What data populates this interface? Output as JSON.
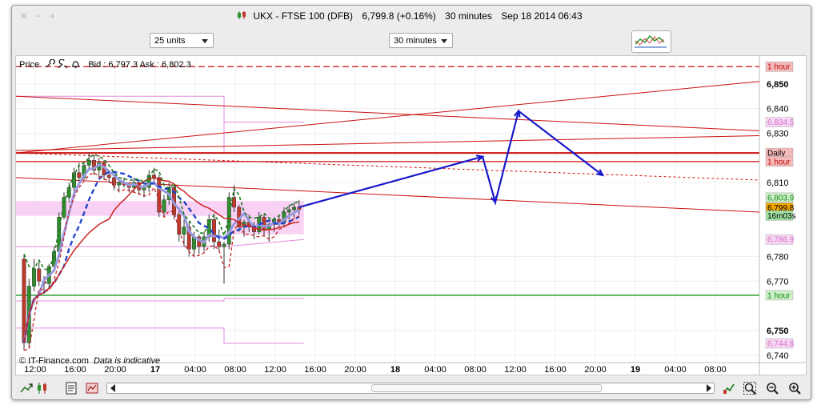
{
  "window": {
    "title_instrument": "UKX - FTSE 100 (DFB)",
    "title_price": "6,799.8 (+0.16%)",
    "title_interval": "30 minutes",
    "title_datetime": "Sep 18 2014 06:43"
  },
  "toolbar": {
    "units_select": "25 units",
    "interval_select": "30 minutes"
  },
  "chart_header": {
    "price_label": "Price",
    "bid_ask": "Bid : 6,797.3 Ask : 6,802.3"
  },
  "credit": {
    "source": "© IT-Finance.com",
    "disclaimer": "Data is indicative"
  },
  "chart_data": {
    "type": "line",
    "ylim": [
      6737,
      6860
    ],
    "y_ticks": [
      {
        "value": 6850,
        "label": "6,850",
        "bold": true
      },
      {
        "value": 6840,
        "label": "6,840",
        "bold": false
      },
      {
        "value": 6830,
        "label": "6,830",
        "bold": false
      },
      {
        "value": 6810,
        "label": "6,810",
        "bold": false
      },
      {
        "value": 6780,
        "label": "6,780",
        "bold": false
      },
      {
        "value": 6770,
        "label": "6,770",
        "bold": false
      },
      {
        "value": 6750,
        "label": "6,750",
        "bold": true
      },
      {
        "value": 6740,
        "label": "6,740",
        "bold": false
      }
    ],
    "x_ticks": [
      {
        "label": "12:00",
        "bold": false
      },
      {
        "label": "16:00",
        "bold": false
      },
      {
        "label": "20:00",
        "bold": false
      },
      {
        "label": "17",
        "bold": true
      },
      {
        "label": "04:00",
        "bold": false
      },
      {
        "label": "08:00",
        "bold": false
      },
      {
        "label": "12:00",
        "bold": false
      },
      {
        "label": "16:00",
        "bold": false
      },
      {
        "label": "20:00",
        "bold": false
      },
      {
        "label": "18",
        "bold": true
      },
      {
        "label": "04:00",
        "bold": false
      },
      {
        "label": "08:00",
        "bold": false
      },
      {
        "label": "12:00",
        "bold": false
      },
      {
        "label": "16:00",
        "bold": false
      },
      {
        "label": "20:00",
        "bold": false
      },
      {
        "label": "19",
        "bold": true
      },
      {
        "label": "04:00",
        "bold": false
      },
      {
        "label": "08:00",
        "bold": false
      }
    ],
    "axis_tags": [
      {
        "label": "1 hour",
        "value": 6857,
        "bg": "#f4b8b8",
        "fg": "#c01010"
      },
      {
        "label": "6,834.5",
        "value": 6834.5,
        "bg": "#f8d8f4",
        "fg": "#d070c8"
      },
      {
        "label": "Daily",
        "value": 6822,
        "bg": "#f4b8b8",
        "fg": "#000000"
      },
      {
        "label": "1 hour",
        "value": 6818.5,
        "bg": "#f4b8b8",
        "fg": "#c01010"
      },
      {
        "label": "6,803.9",
        "value": 6803.9,
        "bg": "#cdeec8",
        "fg": "#138a13"
      },
      {
        "label": "6,799.8",
        "value": 6799.8,
        "bg": "#f0a400",
        "fg": "#000000"
      },
      {
        "label": "16m03s",
        "value": 6796.6,
        "bg": "#9fe29f",
        "fg": "#000000"
      },
      {
        "label": "6,786.9",
        "value": 6786.9,
        "bg": "#f8d8f4",
        "fg": "#d070c8"
      },
      {
        "label": "1 hour",
        "value": 6764.3,
        "bg": "#cdeec8",
        "fg": "#138a13"
      },
      {
        "label": "6,744.8",
        "value": 6744.8,
        "bg": "#f8d8f4",
        "fg": "#d070c8"
      }
    ],
    "colors": {
      "bull_candle": "#2f8f2f",
      "bear_candle": "#c0392b",
      "resistance": "#cc1111",
      "support": "#2a9a2a",
      "envelope": "#e48ae0",
      "ma_lavender": "#9a9ae0",
      "ma_blue": "#2244cc",
      "ma_green": "#1a7a1a",
      "ma_red": "#cc2222",
      "projection": "#1818cc"
    },
    "series": [
      {
        "kind": "candles",
        "ohlc": [
          [
            6779,
            6781,
            6742,
            6745
          ],
          [
            6745,
            6771,
            6743,
            6768
          ],
          [
            6768,
            6779,
            6766,
            6775
          ],
          [
            6775,
            6778,
            6768,
            6770
          ],
          [
            6770,
            6772,
            6765,
            6769
          ],
          [
            6769,
            6777,
            6767,
            6776
          ],
          [
            6776,
            6784,
            6774,
            6782
          ],
          [
            6782,
            6798,
            6781,
            6796
          ],
          [
            6796,
            6806,
            6795,
            6804
          ],
          [
            6804,
            6810,
            6802,
            6808
          ],
          [
            6808,
            6816,
            6806,
            6814
          ],
          [
            6814,
            6818,
            6810,
            6812
          ],
          [
            6812,
            6818,
            6811,
            6817
          ],
          [
            6817,
            6822,
            6815,
            6819
          ],
          [
            6819,
            6821,
            6813,
            6815
          ],
          [
            6815,
            6820,
            6812,
            6818
          ],
          [
            6818,
            6819,
            6811,
            6813
          ],
          [
            6813,
            6815,
            6810,
            6812
          ],
          [
            6812,
            6813,
            6807,
            6809
          ],
          [
            6809,
            6811,
            6806,
            6810
          ],
          [
            6810,
            6812,
            6808,
            6809
          ],
          [
            6809,
            6810,
            6806,
            6808
          ],
          [
            6808,
            6812,
            6806,
            6810
          ],
          [
            6810,
            6811,
            6805,
            6807
          ],
          [
            6807,
            6809,
            6804,
            6808
          ],
          [
            6808,
            6815,
            6806,
            6813
          ],
          [
            6813,
            6816,
            6810,
            6812
          ],
          [
            6812,
            6813,
            6796,
            6798
          ],
          [
            6798,
            6805,
            6796,
            6803
          ],
          [
            6803,
            6810,
            6801,
            6808
          ],
          [
            6808,
            6809,
            6795,
            6797
          ],
          [
            6797,
            6799,
            6786,
            6789
          ],
          [
            6789,
            6795,
            6784,
            6792
          ],
          [
            6792,
            6794,
            6780,
            6783
          ],
          [
            6783,
            6790,
            6780,
            6788
          ],
          [
            6788,
            6789,
            6781,
            6784
          ],
          [
            6784,
            6790,
            6782,
            6788
          ],
          [
            6788,
            6797,
            6786,
            6795
          ],
          [
            6795,
            6797,
            6783,
            6786
          ],
          [
            6786,
            6791,
            6782,
            6784
          ],
          [
            6784,
            6786,
            6769,
            6785
          ],
          [
            6785,
            6806,
            6783,
            6804
          ],
          [
            6804,
            6809,
            6798,
            6800
          ],
          [
            6800,
            6801,
            6790,
            6792
          ],
          [
            6792,
            6795,
            6788,
            6794
          ],
          [
            6794,
            6797,
            6790,
            6792
          ],
          [
            6792,
            6794,
            6787,
            6790
          ],
          [
            6790,
            6798,
            6789,
            6796
          ],
          [
            6796,
            6797,
            6788,
            6791
          ],
          [
            6791,
            6794,
            6786,
            6793
          ],
          [
            6793,
            6796,
            6790,
            6795
          ],
          [
            6795,
            6797,
            6792,
            6794
          ],
          [
            6794,
            6800,
            6792,
            6798
          ],
          [
            6798,
            6801,
            6795,
            6799
          ],
          [
            6799,
            6802,
            6796,
            6800
          ],
          [
            6800,
            6803,
            6797,
            6799
          ]
        ]
      }
    ]
  }
}
